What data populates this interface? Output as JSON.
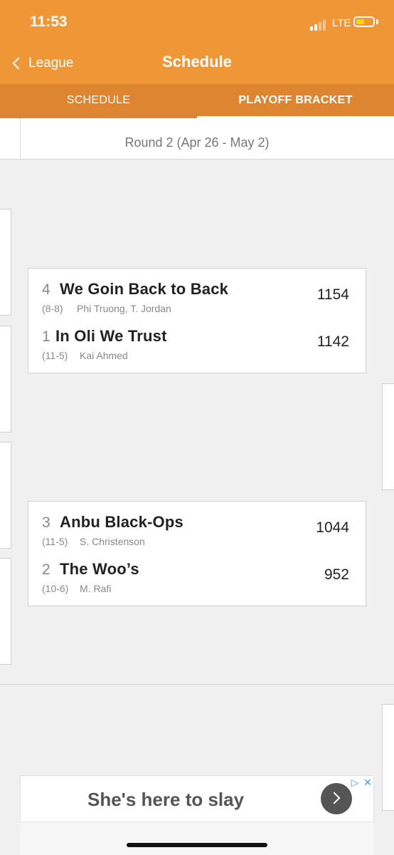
{
  "status_bar": {
    "time": "11:53",
    "network": "LTE",
    "battery_level": 0.45
  },
  "nav": {
    "back_label": "League",
    "title": "Schedule"
  },
  "tabs": [
    {
      "label": "SCHEDULE",
      "selected": false
    },
    {
      "label": "PLAYOFF BRACKET",
      "selected": true
    }
  ],
  "round_header": "Round 2 (Apr 26 - May 2)",
  "matchups": [
    {
      "teams": [
        {
          "seed": "4",
          "name": "We Goin Back to Back",
          "record": "(8-8)",
          "owner": "Phi Truong, T. Jordan",
          "score": "1154"
        },
        {
          "seed": "1",
          "name": "In Oli We Trust",
          "record": "(11-5)",
          "owner": "Kai Ahmed",
          "score": "1142"
        }
      ]
    },
    {
      "teams": [
        {
          "seed": "3",
          "name": "Anbu Black-Ops",
          "record": "(11-5)",
          "owner": "S. Christenson",
          "score": "1044"
        },
        {
          "seed": "2",
          "name": "The Woo’s",
          "record": "(10-6)",
          "owner": "M. Rafi",
          "score": "952"
        }
      ]
    }
  ],
  "ad": {
    "text": "She's here to slay"
  },
  "colors": {
    "header": "#ef9637",
    "tab_bar": "#dd8530",
    "background": "#f0f0f0"
  }
}
